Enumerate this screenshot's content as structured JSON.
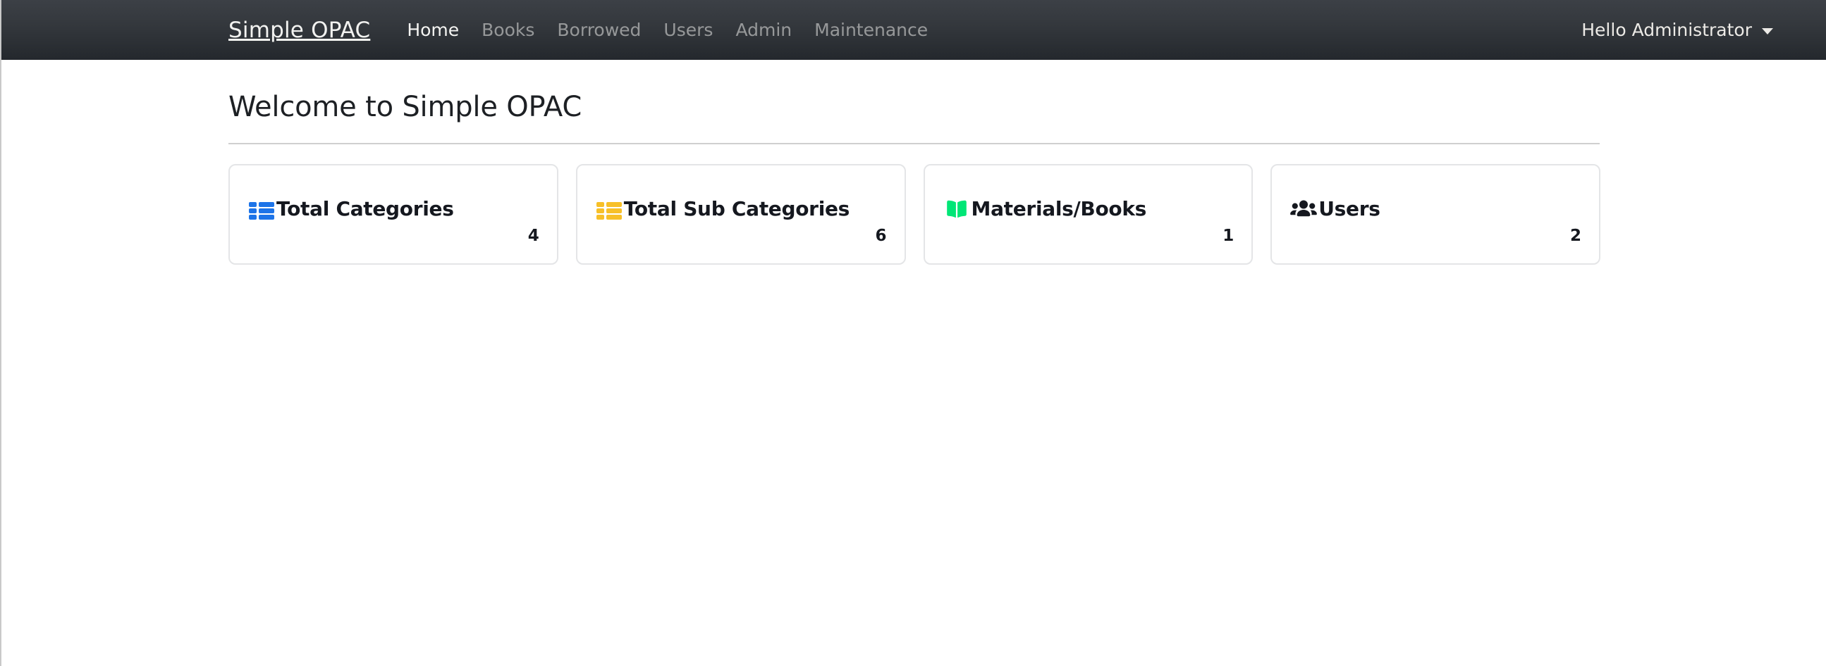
{
  "navbar": {
    "brand": "Simple OPAC",
    "links": [
      {
        "label": "Home",
        "active": true
      },
      {
        "label": "Books",
        "active": false
      },
      {
        "label": "Borrowed",
        "active": false
      },
      {
        "label": "Users",
        "active": false
      },
      {
        "label": "Admin",
        "active": false
      },
      {
        "label": "Maintenance",
        "active": false
      }
    ],
    "user_greeting": "Hello Administrator",
    "caret_icon": "chevron-down-icon",
    "background_color": "#33373c"
  },
  "main": {
    "page_title": "Welcome to Simple OPAC",
    "cards": [
      {
        "label": "Total Categories",
        "count": "4",
        "icon": "table-list-icon",
        "icon_color": "#1d74e8"
      },
      {
        "label": "Total Sub Categories",
        "count": "6",
        "icon": "table-list-icon",
        "icon_color": "#f7c028"
      },
      {
        "label": "Materials/Books",
        "count": "1",
        "icon": "open-book-icon",
        "icon_color": "#00e676"
      },
      {
        "label": "Users",
        "count": "2",
        "icon": "users-group-icon",
        "icon_color": "#15181f"
      }
    ]
  }
}
